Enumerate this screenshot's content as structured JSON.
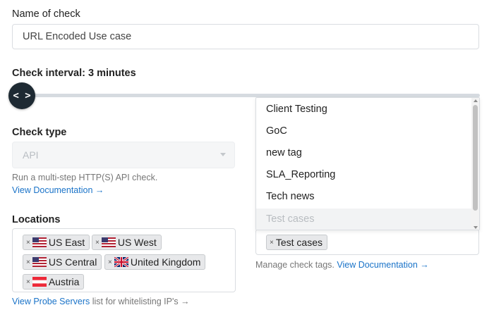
{
  "form": {
    "name_label": "Name of check",
    "name_value": "URL Encoded Use case",
    "interval_label": "Check interval: 3 minutes",
    "slider_handle_glyph": "< >",
    "check_type_label": "Check type",
    "check_type_value": "API",
    "check_type_help": "Run a multi-step HTTP(S) API check.",
    "check_type_doc_link": "View Documentation →",
    "locations_label": "Locations",
    "locations": [
      {
        "label": "US East",
        "flag": "us-flag"
      },
      {
        "label": "US West",
        "flag": "us-flag"
      },
      {
        "label": "US Central",
        "flag": "us-flag"
      },
      {
        "label": "United Kingdom",
        "flag": "uk-flag"
      },
      {
        "label": "Austria",
        "flag": "austria-flag"
      }
    ],
    "chip_remove_glyph": "×",
    "probe_link": "View Probe Servers",
    "probe_help": " list for whitelisting IP's →",
    "tags_dropdown": [
      "Client Testing",
      "GoC",
      "new tag",
      "SLA_Reporting",
      "Tech news",
      "Test cases"
    ],
    "tags_selected": [
      "Test cases"
    ],
    "tags_help": "Manage check tags. ",
    "tags_doc_link": "View Documentation →"
  },
  "colors": {
    "link": "#1a73c8",
    "slider_handle": "#1e2a33",
    "chip_bg": "#e7e8ea"
  }
}
